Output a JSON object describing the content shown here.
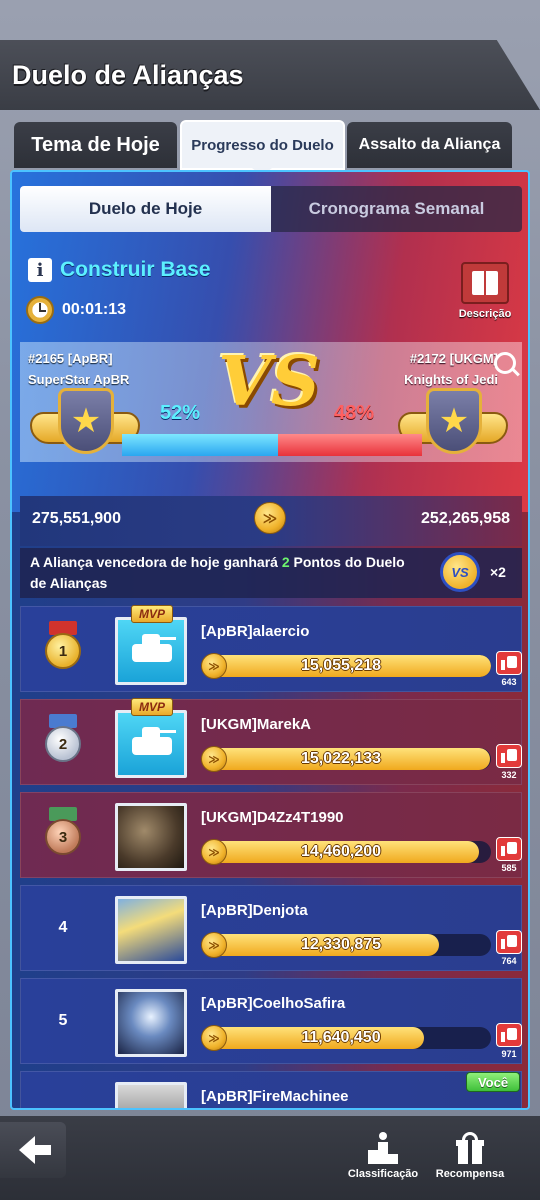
{
  "header": {
    "title": "Duelo de Alianças"
  },
  "tabs": [
    {
      "label": "Tema de Hoje"
    },
    {
      "label": "Progresso do Duelo"
    },
    {
      "label": "Assalto da Aliança"
    }
  ],
  "subtabs": [
    {
      "label": "Duelo de Hoje"
    },
    {
      "label": "Cronograma Semanal"
    }
  ],
  "mission": {
    "title": "Construir Base",
    "timer": "00:01:13",
    "description_label": "Descrição"
  },
  "duel": {
    "left": {
      "id": "#2165 [ApBR]",
      "name": "SuperStar ApBR",
      "percent": "52%",
      "score": "275,551,900"
    },
    "right": {
      "id": "#2172 [UKGM]",
      "name": "Knights of Jedi",
      "percent": "48%",
      "score": "252,265,958"
    },
    "progress_left_fraction": 0.52,
    "vs_label": "VS"
  },
  "reward": {
    "text_before": "A Aliança vencedora de hoje ganhará ",
    "points": "2",
    "text_after": " Pontos do Duelo de Alianças",
    "badge": "VS",
    "multiplier": "×2"
  },
  "ranking": [
    {
      "position": "1",
      "name": "[ApBR]alaercio",
      "score": "15,055,218",
      "likes": "643",
      "mvp": "MVP",
      "fill": 1.0
    },
    {
      "position": "2",
      "name": "[UKGM]MarekA",
      "score": "15,022,133",
      "likes": "332",
      "mvp": "MVP",
      "fill": 0.998
    },
    {
      "position": "3",
      "name": "[UKGM]D4Zz4T1990",
      "score": "14,460,200",
      "likes": "585",
      "fill": 0.96
    },
    {
      "position": "4",
      "name": "[ApBR]Denjota",
      "score": "12,330,875",
      "likes": "764",
      "fill": 0.82
    },
    {
      "position": "5",
      "name": "[ApBR]CoelhoSafira",
      "score": "11,640,450",
      "likes": "971",
      "fill": 0.77
    },
    {
      "position": "",
      "name": "[ApBR]FireMachinee",
      "you_tag": "Você"
    }
  ],
  "bottom": {
    "ranking_label": "Classificação",
    "reward_label": "Recompensa"
  },
  "colors": {
    "blue_team": "#5cf0ff",
    "red_team": "#ff6060",
    "accent_gold": "#f0b22a"
  },
  "icons": [
    "info-icon",
    "clock-icon",
    "book-icon",
    "search-icon",
    "coin-icon",
    "like-icon",
    "back-arrow-icon",
    "podium-icon",
    "gift-icon"
  ]
}
